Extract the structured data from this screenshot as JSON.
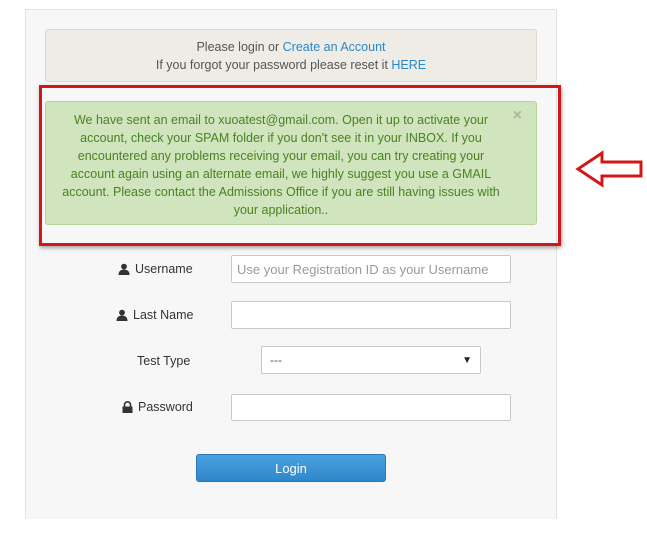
{
  "info": {
    "line1_prefix": "Please login or",
    "create_account_link": "Create an Account",
    "line2_prefix": "If you forgot your password please reset it",
    "reset_link": "HERE"
  },
  "alert": {
    "message": "We have sent an email to xuoatest@gmail.com. Open it up to activate your account, check your SPAM folder if you don't see it in your INBOX. If you encountered any problems receiving your email, you can try creating your account again using an alternate email, we highly suggest you use a GMAIL account. Please contact the Admissions Office if you are still having issues with your application..",
    "close_glyph": "×"
  },
  "form": {
    "username_label": "Username",
    "username_placeholder": "Use your Registration ID as your Username",
    "lastname_label": "Last Name",
    "test_type_label": "Test Type",
    "test_type_value": "---",
    "password_label": "Password",
    "login_button": "Login"
  },
  "colors": {
    "alert_bg": "#d0e4bd",
    "alert_text": "#4a8225",
    "annotation_red": "#d01818",
    "button_blue": "#2f86c9",
    "link_blue": "#2a88c8"
  },
  "icons": {
    "username": "user-icon",
    "lastname": "user-icon",
    "password": "lock-icon",
    "annotation": "left-arrow-icon"
  }
}
